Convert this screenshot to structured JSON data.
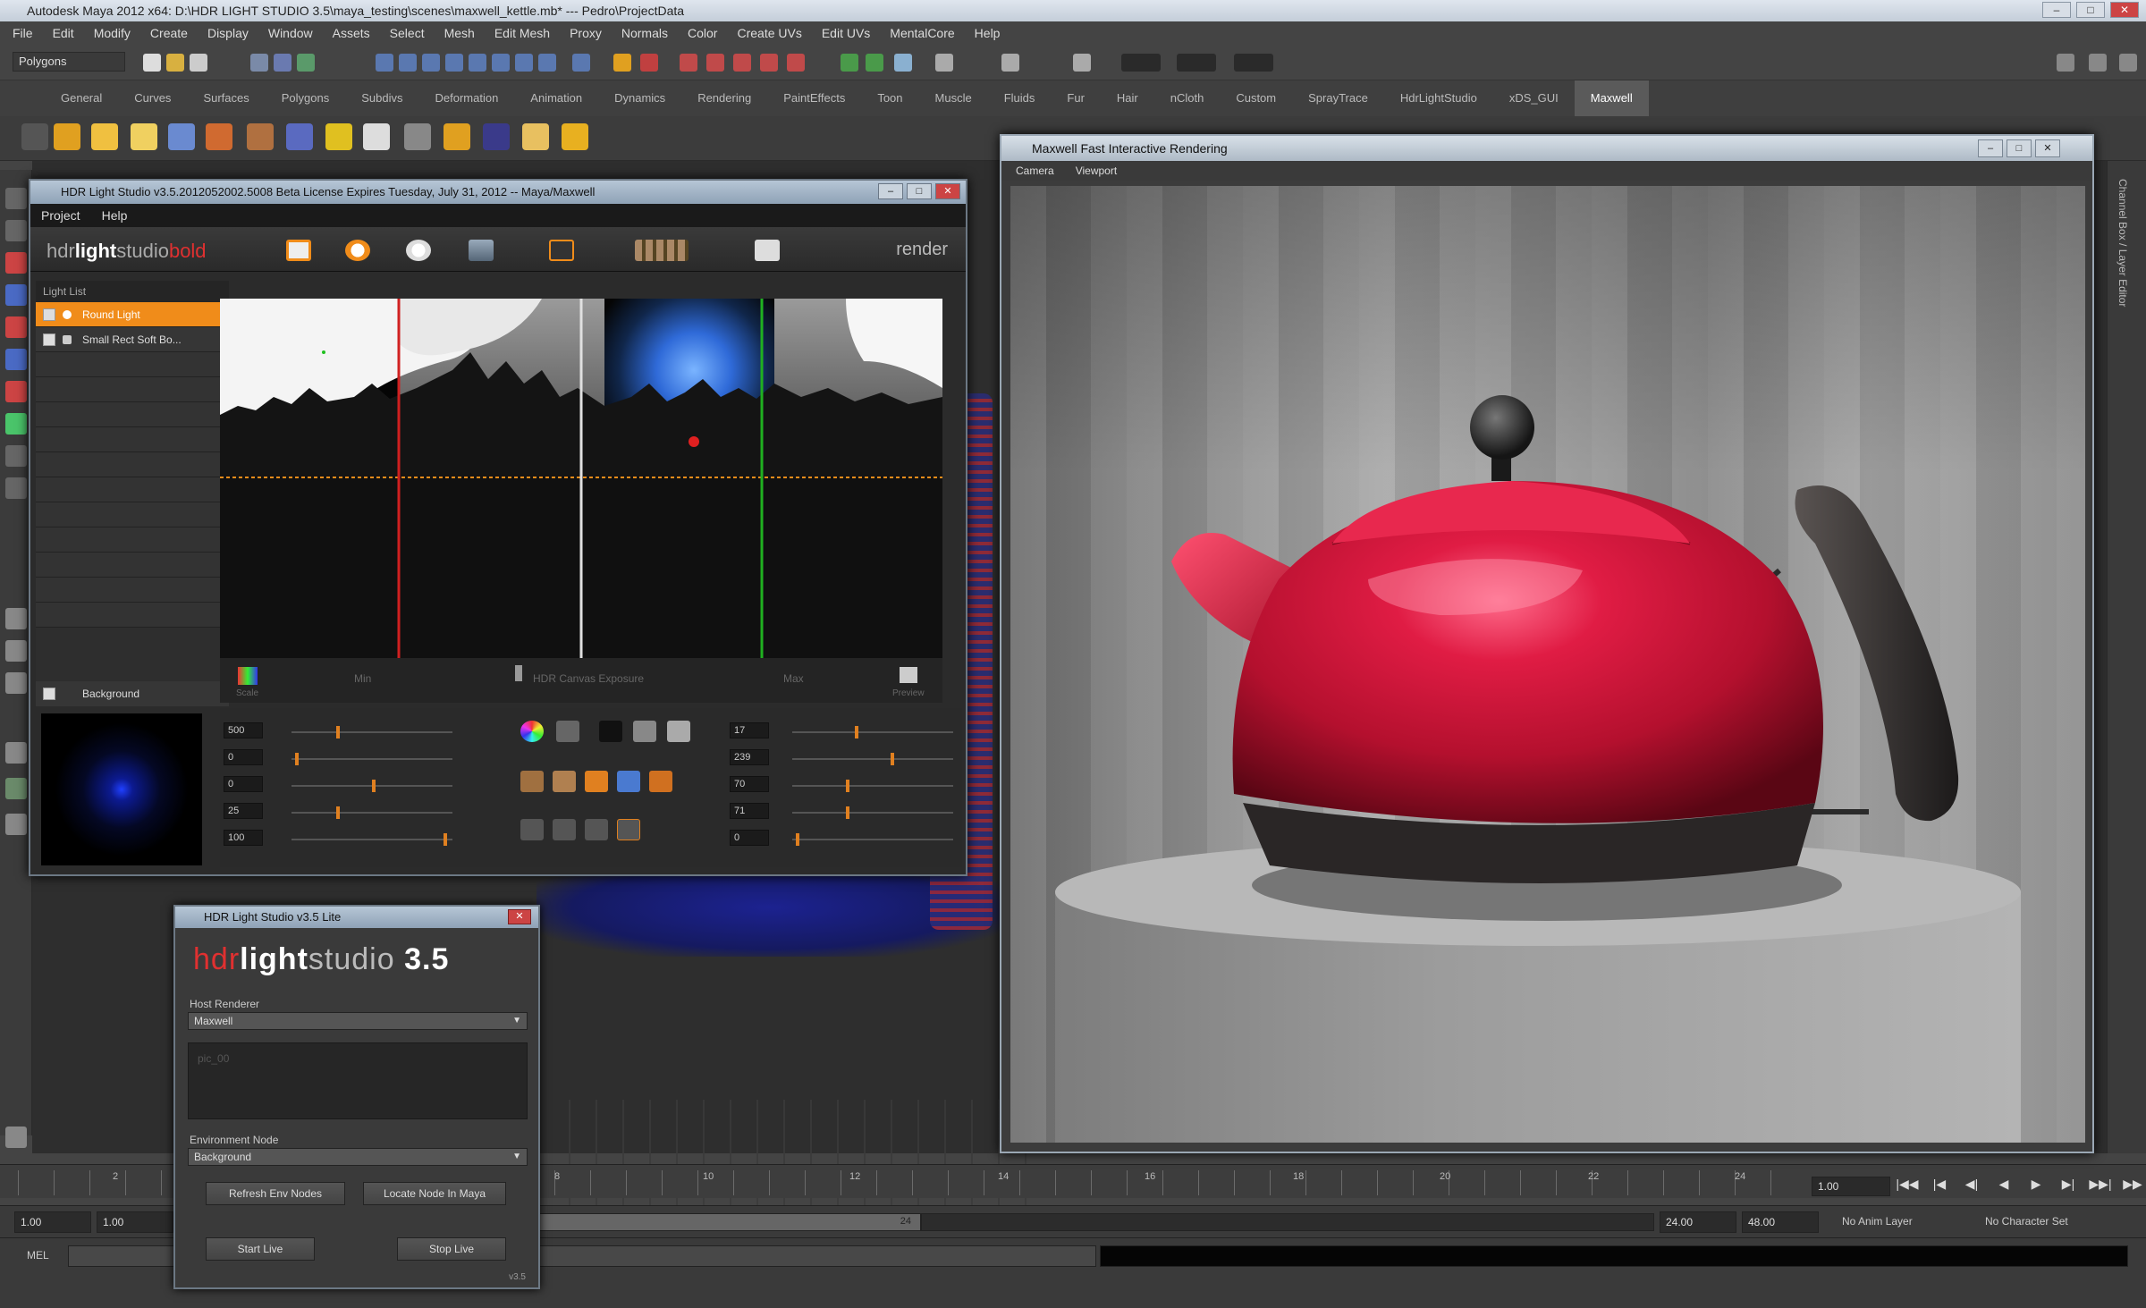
{
  "app": {
    "title": "Autodesk Maya 2012 x64: D:\\HDR LIGHT STUDIO 3.5\\maya_testing\\scenes\\maxwell_kettle.mb* --- Pedro\\ProjectData",
    "window_buttons": [
      "–",
      "□",
      "✕"
    ]
  },
  "menubar": [
    "File",
    "Edit",
    "Modify",
    "Create",
    "Display",
    "Window",
    "Assets",
    "Select",
    "Mesh",
    "Edit Mesh",
    "Proxy",
    "Normals",
    "Color",
    "Create UVs",
    "Edit UVs",
    "MentalCore",
    "Help"
  ],
  "mode_selector": "Polygons",
  "shelf_tabs": [
    "General",
    "Curves",
    "Surfaces",
    "Polygons",
    "Subdivs",
    "Deformation",
    "Animation",
    "Dynamics",
    "Rendering",
    "PaintEffects",
    "Toon",
    "Muscle",
    "Fluids",
    "Fur",
    "Hair",
    "nCloth",
    "Custom",
    "SprayTrace",
    "HdrLightStudio",
    "xDS_GUI",
    "Maxwell"
  ],
  "active_shelf_tab": "Maxwell",
  "right_strip_label": "Channel Box / Layer Editor",
  "hdr_window": {
    "title": "HDR Light Studio v3.5.2012052002.5008 Beta License Expires Tuesday, July 31, 2012 -- Maya/Maxwell",
    "menu": [
      "Project",
      "Help"
    ],
    "logo": {
      "hdr": "hdr",
      "light": "light",
      "studio": "studio",
      "bold": "bold"
    },
    "render_label": "render",
    "light_list_header": "Light List",
    "lights": [
      {
        "name": "Round Light",
        "selected": true
      },
      {
        "name": "Small Rect Soft Bo...",
        "selected": false
      }
    ],
    "background_label": "Background",
    "canvas_labels": {
      "left": "Scale",
      "mid_left": "Min",
      "center": "HDR Canvas Exposure",
      "mid_right": "Max",
      "right": "Preview"
    },
    "control_values_left": [
      "500",
      "0",
      "0",
      "25",
      "100"
    ],
    "control_values_right": [
      "17",
      "239",
      "70",
      "71",
      "0"
    ]
  },
  "lite_window": {
    "title": "HDR Light Studio v3.5 Lite",
    "logo": {
      "hdr": "hdr",
      "light": "light",
      "studio": "studio",
      "version": "3.5"
    },
    "host_renderer_label": "Host Renderer",
    "host_renderer_value": "Maxwell",
    "text_area": "pic_00",
    "env_node_label": "Environment Node",
    "env_node_value": "Background",
    "buttons": {
      "refresh": "Refresh Env Nodes",
      "locate": "Locate Node In Maya",
      "start": "Start Live",
      "stop": "Stop Live"
    },
    "version": "v3.5"
  },
  "fire_window": {
    "title": "Maxwell Fast Interactive Rendering",
    "menu": [
      "Camera",
      "Viewport"
    ],
    "colors": {
      "kettle": "#d0153a",
      "handle": "#2a2624"
    }
  },
  "timeline": {
    "frame_numbers": [
      "2",
      "4",
      "6",
      "8",
      "10",
      "12",
      "14",
      "16",
      "18",
      "20",
      "22",
      "24"
    ],
    "current_frame": "1.00",
    "playback": [
      "|◀◀",
      "|◀",
      "◀|",
      "◀",
      "▶",
      "▶|",
      "▶▶|",
      "▶▶"
    ]
  },
  "range": {
    "start": "1.00",
    "start2": "1.00",
    "range_mid": "24",
    "end": "24.00",
    "end2": "48.00",
    "anim_layer": "No Anim Layer",
    "char_set": "No Character Set"
  },
  "mel_label": "MEL"
}
